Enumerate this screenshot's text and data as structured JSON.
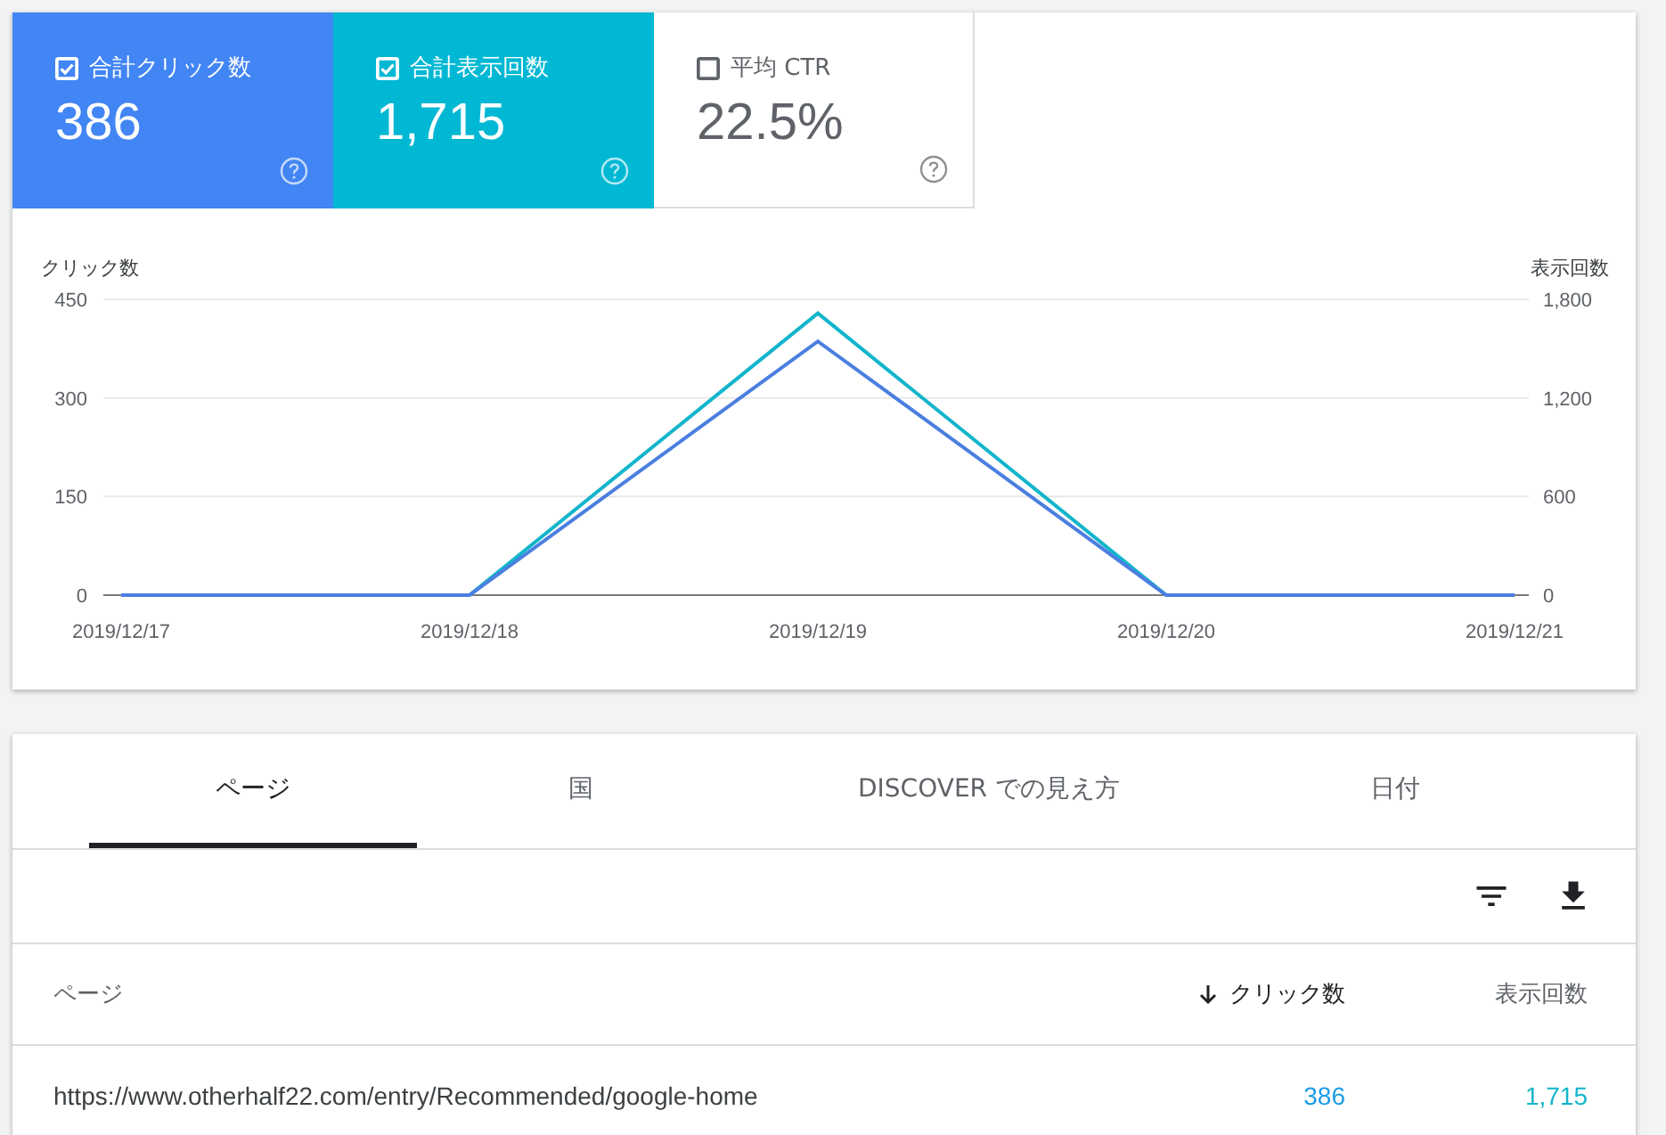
{
  "metrics": [
    {
      "label": "合計クリック数",
      "value": "386",
      "checked": true,
      "color": "#4285f4"
    },
    {
      "label": "合計表示回数",
      "value": "1,715",
      "checked": true,
      "color": "#00b8d4"
    },
    {
      "label": "平均 CTR",
      "value": "22.5%",
      "checked": false
    }
  ],
  "chart": {
    "chart_data": {
      "type": "line",
      "ylabel": "クリック数",
      "y2label": "表示回数",
      "categories": [
        "2019/12/17",
        "2019/12/18",
        "2019/12/19",
        "2019/12/20",
        "2019/12/21"
      ],
      "ylim": [
        0,
        450
      ],
      "yticks": [
        0,
        150,
        300,
        450
      ],
      "y2lim": [
        0,
        1800
      ],
      "y2ticks": [
        {
          "value": 0,
          "label": "0"
        },
        {
          "value": 600,
          "label": "600"
        },
        {
          "value": 1200,
          "label": "1,200"
        },
        {
          "value": 1800,
          "label": "1,800"
        }
      ],
      "series": [
        {
          "color": "#12b5cb",
          "axis": "y2",
          "values": [
            0,
            0,
            1715,
            0,
            0
          ]
        },
        {
          "color": "#4a7fe0",
          "values": [
            0,
            0,
            386,
            0,
            0
          ]
        }
      ]
    }
  },
  "tabs": [
    {
      "label": "ページ",
      "selected": true
    },
    {
      "label": "国",
      "selected": false
    },
    {
      "label": "DISCOVER での見え方",
      "selected": false
    },
    {
      "label": "日付",
      "selected": false
    }
  ],
  "table": {
    "columns": [
      {
        "label": "ページ",
        "sorted": false
      },
      {
        "label": "クリック数",
        "sorted": true
      },
      {
        "label": "表示回数",
        "sorted": false
      }
    ],
    "rows": [
      {
        "page": "https://www.otherhalf22.com/entry/Recommended/google-home",
        "clicks": "386",
        "impressions": "1,715"
      }
    ]
  }
}
